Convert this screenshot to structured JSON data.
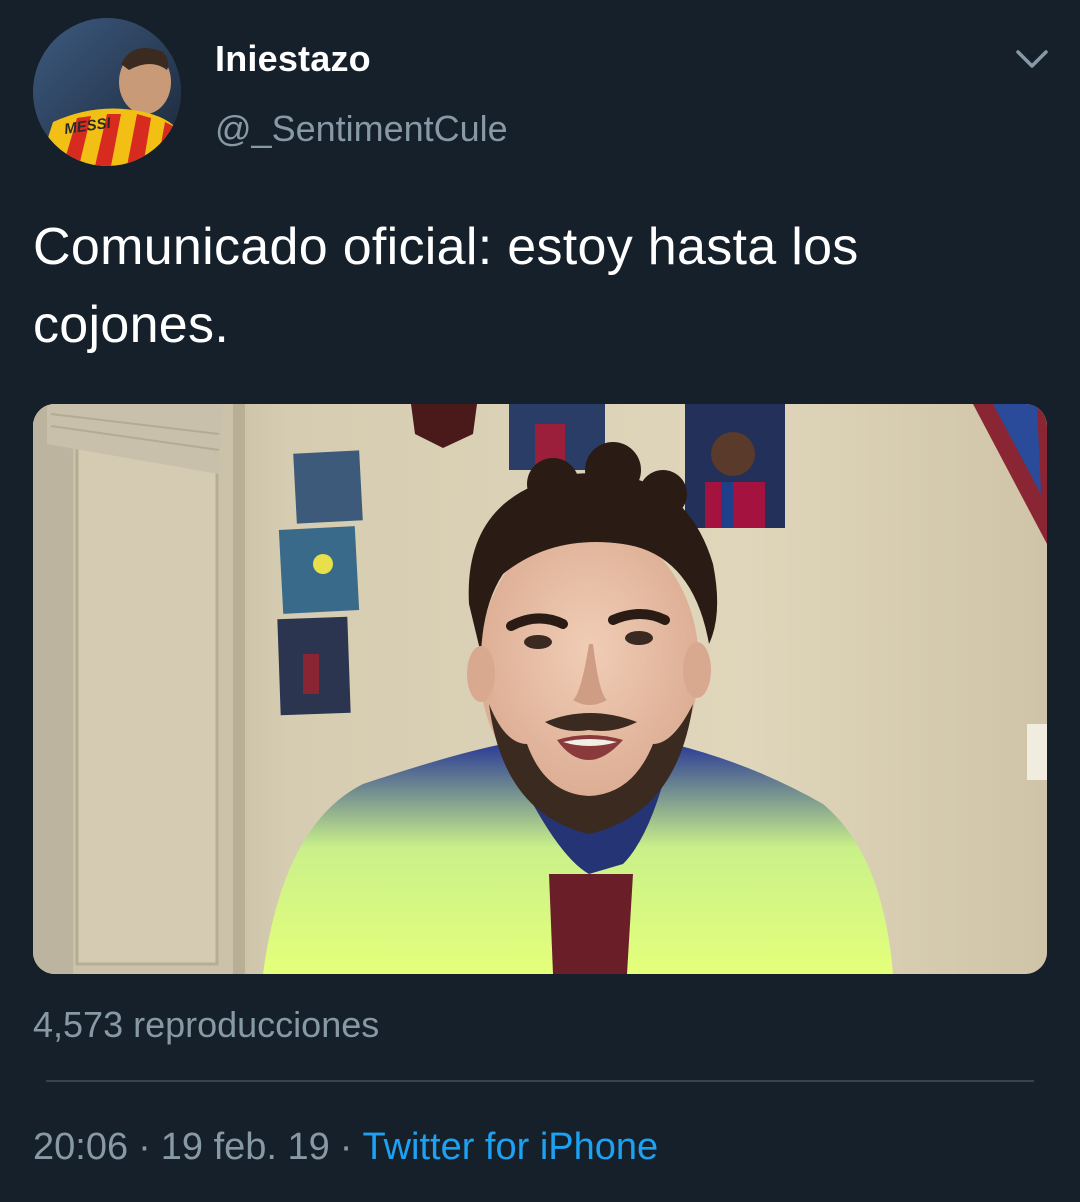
{
  "author": {
    "display_name": "Iniestazo",
    "handle": "@_SentimentCule",
    "avatar_text": "MESSI"
  },
  "menu_icon": "chevron-down-icon",
  "tweet": {
    "text": "Comunicado oficial: estoy hasta los cojones."
  },
  "media": {
    "type": "video"
  },
  "stats": {
    "views": "4,573 reproducciones"
  },
  "meta": {
    "time": "20:06",
    "separator": "·",
    "date": "19 feb. 19",
    "source": "Twitter for iPhone"
  },
  "colors": {
    "background": "#15202b",
    "primary_text": "#ffffff",
    "secondary_text": "#8899a6",
    "link": "#1da1f2",
    "divider": "#38444d"
  }
}
